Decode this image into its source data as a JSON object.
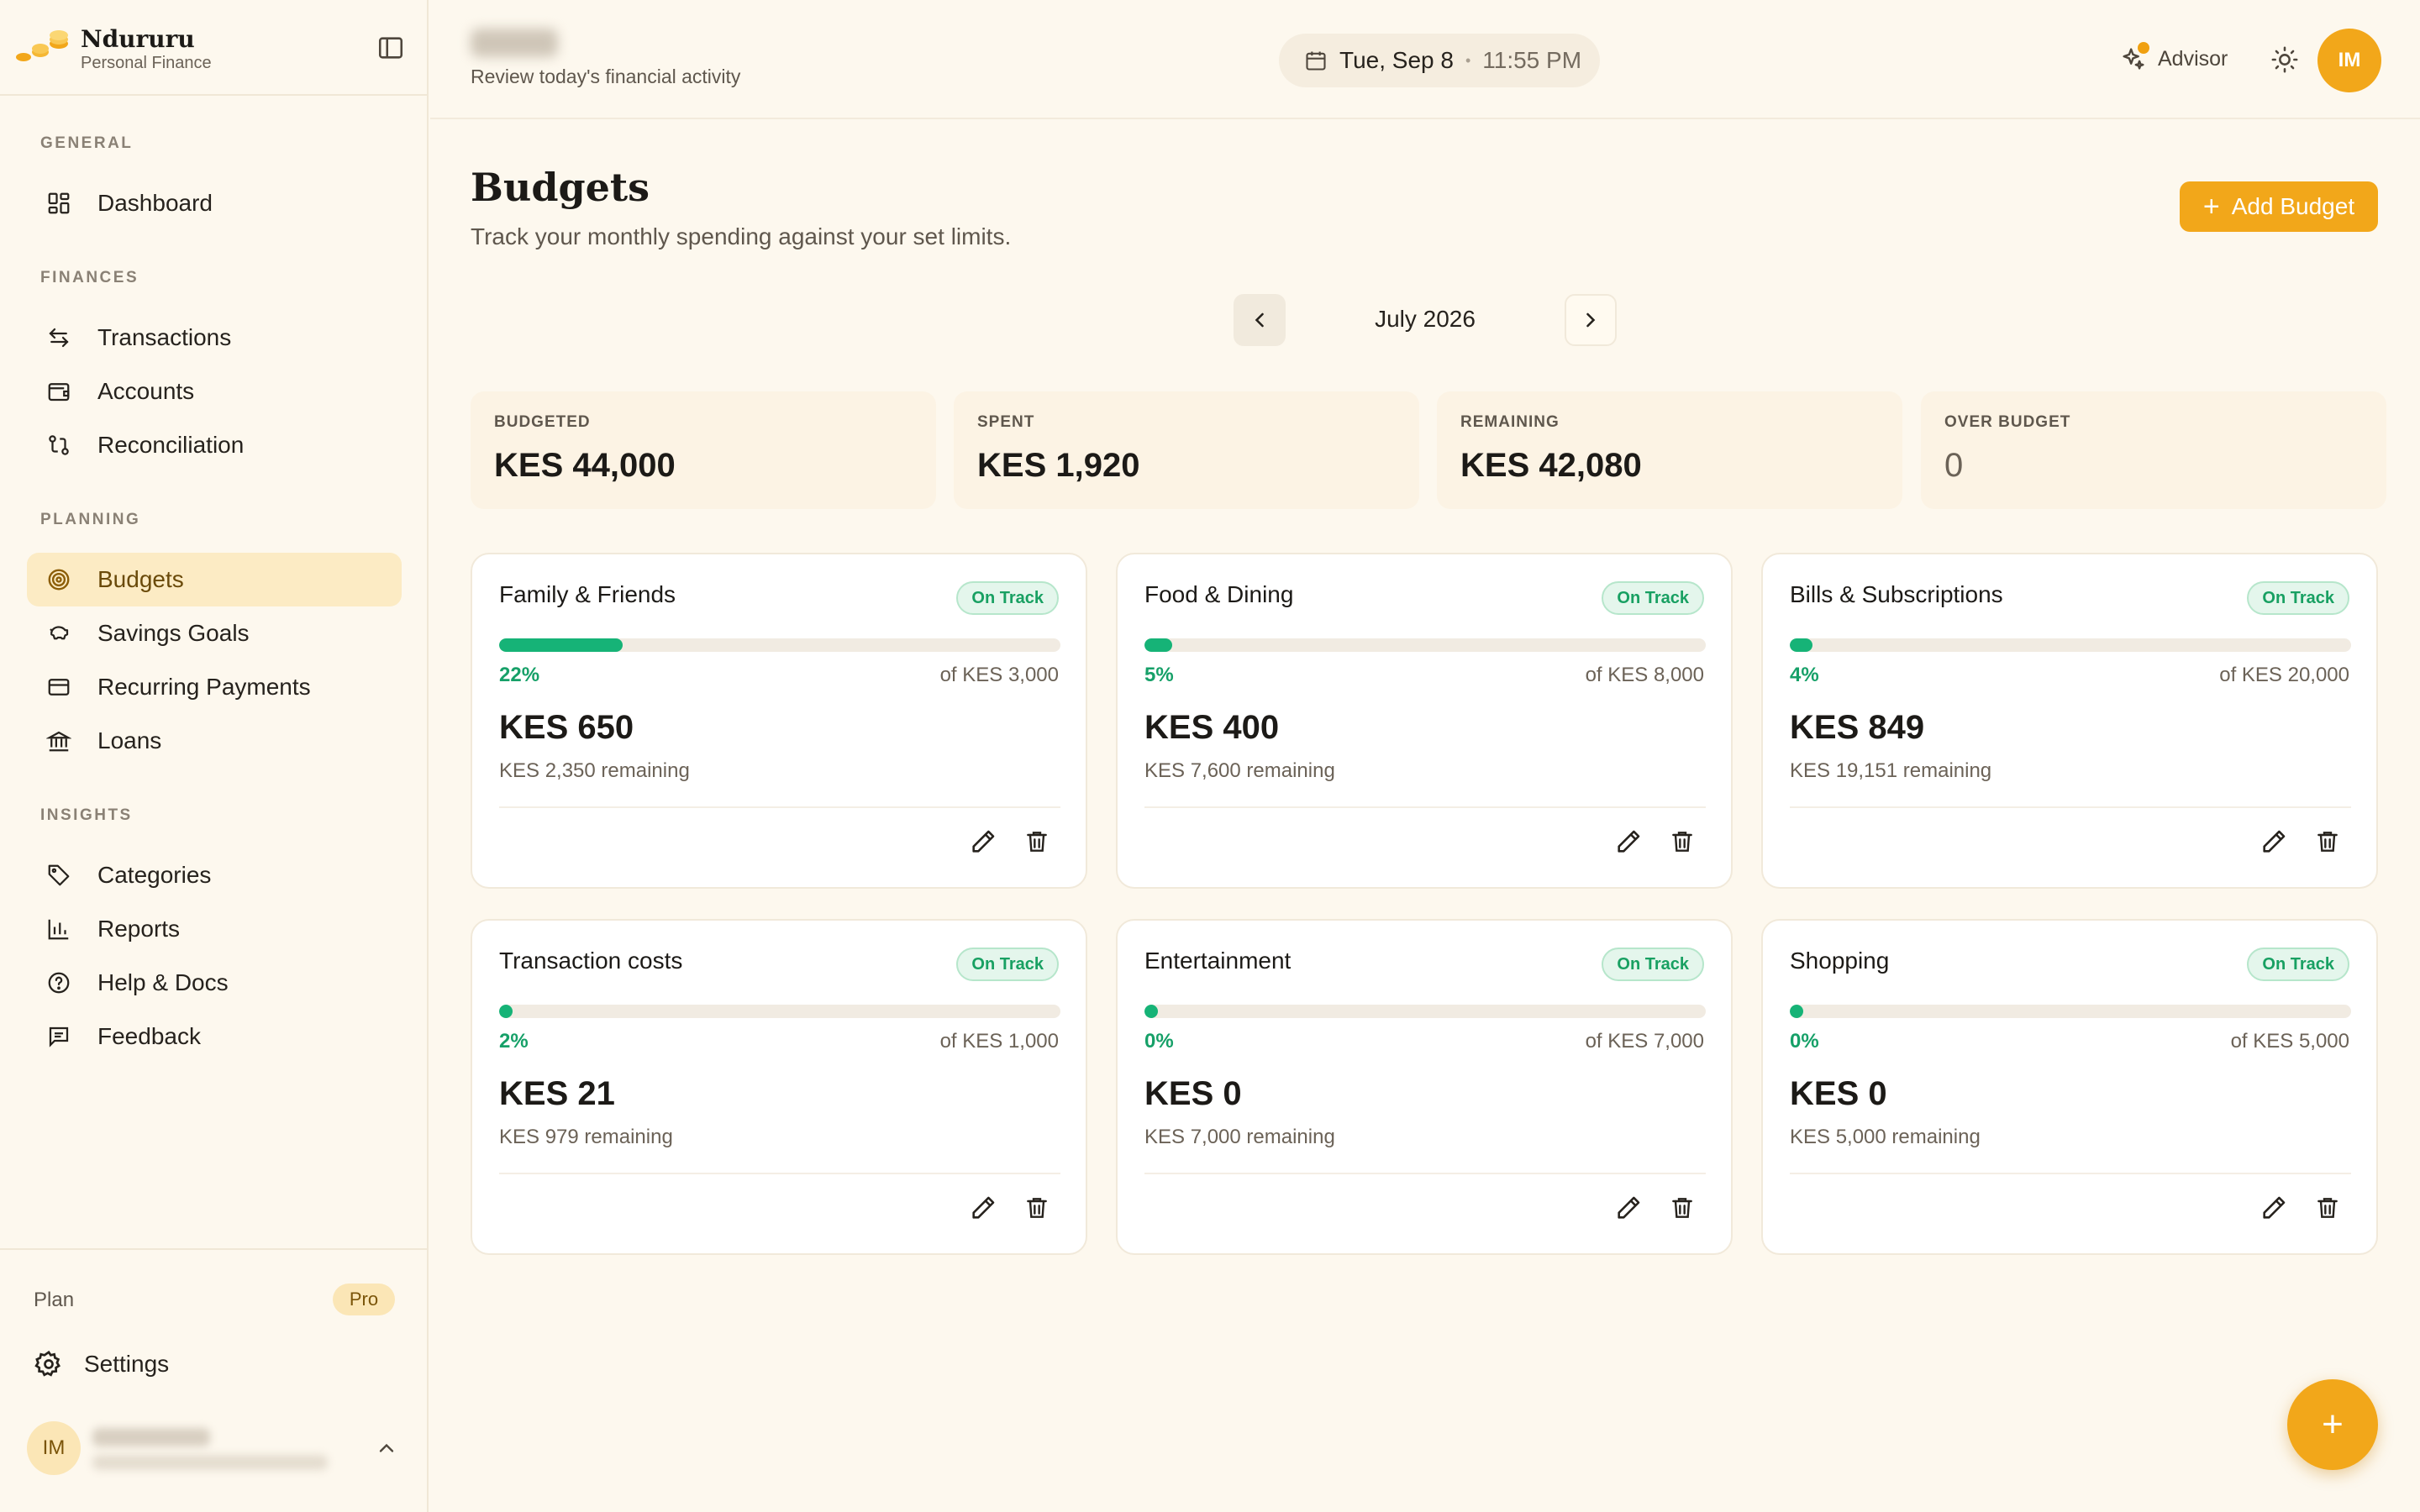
{
  "brand": {
    "name": "Ndururu",
    "tagline": "Personal Finance"
  },
  "sidebar": {
    "sections": [
      {
        "label": "GENERAL",
        "items": [
          {
            "label": "Dashboard",
            "icon": "dashboard-grid-icon"
          }
        ]
      },
      {
        "label": "FINANCES",
        "items": [
          {
            "label": "Transactions",
            "icon": "arrows-swap-icon"
          },
          {
            "label": "Accounts",
            "icon": "wallet-icon"
          },
          {
            "label": "Reconciliation",
            "icon": "git-compare-icon"
          }
        ]
      },
      {
        "label": "PLANNING",
        "items": [
          {
            "label": "Budgets",
            "icon": "target-icon",
            "active": true
          },
          {
            "label": "Savings Goals",
            "icon": "piggy-bank-icon"
          },
          {
            "label": "Recurring Payments",
            "icon": "credit-card-icon"
          },
          {
            "label": "Loans",
            "icon": "bank-icon"
          }
        ]
      },
      {
        "label": "INSIGHTS",
        "items": [
          {
            "label": "Categories",
            "icon": "tag-icon"
          },
          {
            "label": "Reports",
            "icon": "bar-chart-icon"
          },
          {
            "label": "Help & Docs",
            "icon": "help-circle-icon"
          },
          {
            "label": "Feedback",
            "icon": "message-square-icon"
          }
        ]
      }
    ],
    "plan_label": "Plan",
    "plan_badge": "Pro",
    "settings_label": "Settings",
    "user_initials": "IM"
  },
  "header": {
    "subtitle": "Review today's financial activity",
    "date": "Tue, Sep 8",
    "time": "11:55 PM",
    "advisor_label": "Advisor",
    "avatar_initials": "IM"
  },
  "page": {
    "title": "Budgets",
    "subtitle": "Track your monthly spending against your set limits.",
    "add_button": "Add Budget",
    "month": "July 2026"
  },
  "summary": [
    {
      "label": "BUDGETED",
      "value": "KES 44,000"
    },
    {
      "label": "SPENT",
      "value": "KES 1,920"
    },
    {
      "label": "REMAINING",
      "value": "KES 42,080"
    },
    {
      "label": "OVER BUDGET",
      "value": "0"
    }
  ],
  "budgets": [
    {
      "name": "Family & Friends",
      "status": "On Track",
      "percent": "22%",
      "progress": 0.22,
      "limit": "of KES 3,000",
      "spent": "KES 650",
      "remaining": "KES 2,350 remaining"
    },
    {
      "name": "Food & Dining",
      "status": "On Track",
      "percent": "5%",
      "progress": 0.05,
      "limit": "of KES 8,000",
      "spent": "KES 400",
      "remaining": "KES 7,600 remaining"
    },
    {
      "name": "Bills & Subscriptions",
      "status": "On Track",
      "percent": "4%",
      "progress": 0.04,
      "limit": "of KES 20,000",
      "spent": "KES 849",
      "remaining": "KES 19,151 remaining"
    },
    {
      "name": "Transaction costs",
      "status": "On Track",
      "percent": "2%",
      "progress": 0.02,
      "limit": "of KES 1,000",
      "spent": "KES 21",
      "remaining": "KES 979 remaining"
    },
    {
      "name": "Entertainment",
      "status": "On Track",
      "percent": "0%",
      "progress": 0,
      "limit": "of KES 7,000",
      "spent": "KES 0",
      "remaining": "KES 7,000 remaining"
    },
    {
      "name": "Shopping",
      "status": "On Track",
      "percent": "0%",
      "progress": 0,
      "limit": "of KES 5,000",
      "spent": "KES 0",
      "remaining": "KES 5,000 remaining"
    }
  ],
  "colors": {
    "accent": "#f2a71a",
    "success": "#16b377",
    "background": "#fdf8ee",
    "active_nav": "#fcebc4"
  }
}
